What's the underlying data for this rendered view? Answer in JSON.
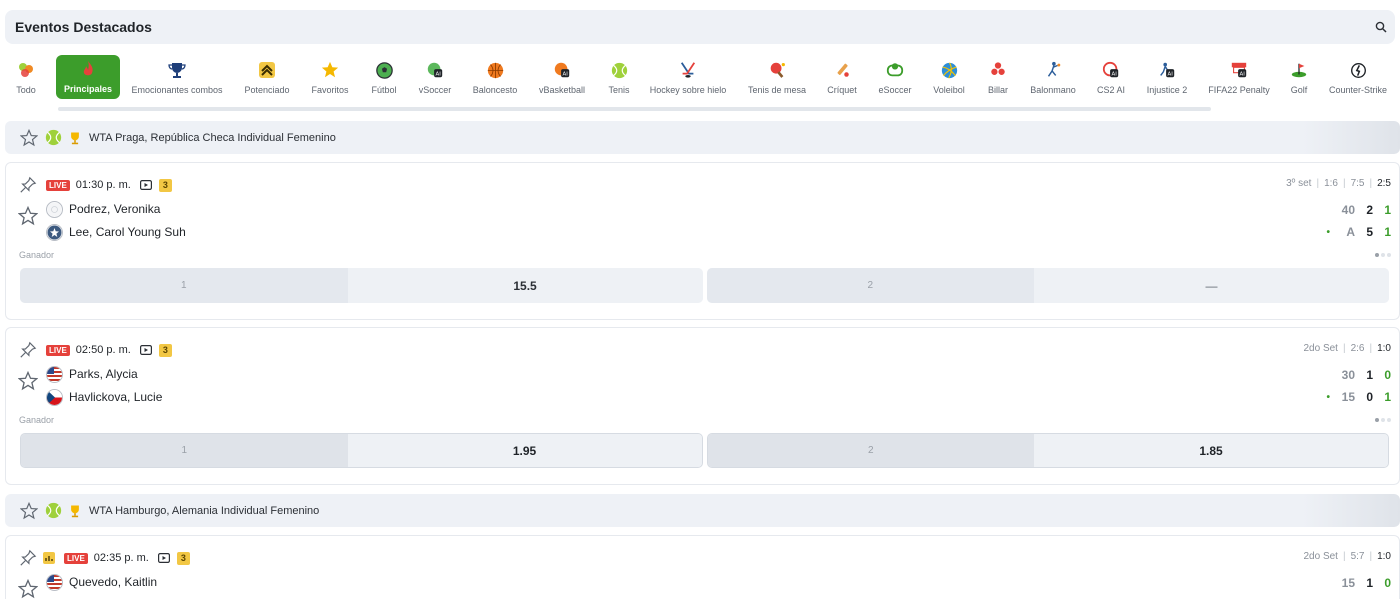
{
  "header": {
    "title": "Eventos Destacados"
  },
  "sports": [
    {
      "label": "Todo",
      "icon": "all-sports-icon"
    },
    {
      "label": "Principales",
      "icon": "flame-icon",
      "active": true
    },
    {
      "label": "Emocionantes combos",
      "icon": "trophy-icon"
    },
    {
      "label": "Potenciado",
      "icon": "boost-icon"
    },
    {
      "label": "Favoritos",
      "icon": "star-icon"
    },
    {
      "label": "Fútbol",
      "icon": "soccer-ball-icon"
    },
    {
      "label": "vSoccer",
      "icon": "vsoccer-icon"
    },
    {
      "label": "Baloncesto",
      "icon": "basketball-icon"
    },
    {
      "label": "vBasketball",
      "icon": "vbasketball-icon"
    },
    {
      "label": "Tenis",
      "icon": "tennis-ball-icon"
    },
    {
      "label": "Hockey sobre hielo",
      "icon": "hockey-icon"
    },
    {
      "label": "Tenis de mesa",
      "icon": "table-tennis-icon"
    },
    {
      "label": "Críquet",
      "icon": "cricket-icon"
    },
    {
      "label": "eSoccer",
      "icon": "esoccer-icon"
    },
    {
      "label": "Voleibol",
      "icon": "volleyball-icon"
    },
    {
      "label": "Billar",
      "icon": "billiards-icon"
    },
    {
      "label": "Balonmano",
      "icon": "handball-icon"
    },
    {
      "label": "CS2 AI",
      "icon": "cs2-icon"
    },
    {
      "label": "Injustice 2",
      "icon": "injustice-icon"
    },
    {
      "label": "FIFA22 Penalty",
      "icon": "fifa-penalty-icon"
    },
    {
      "label": "Golf",
      "icon": "golf-icon"
    },
    {
      "label": "Counter-Strike",
      "icon": "counter-strike-icon"
    }
  ],
  "leagues": [
    {
      "name": "WTA Praga, República Checa Individual Femenino"
    },
    {
      "name": "WTA Hamburgo, Alemania Individual Femenino"
    }
  ],
  "events": [
    {
      "live": "LIVE",
      "time": "01:30 p. m.",
      "count": "3",
      "set_label": "3º set",
      "set_scores": [
        "1:6",
        "7:5"
      ],
      "current": "2:5",
      "players": [
        {
          "name": "Podrez, Veronika",
          "points": "40",
          "games": "2",
          "sets": "1",
          "serve": ""
        },
        {
          "name": "Lee, Carol Young Suh",
          "points": "A",
          "games": "5",
          "sets": "1",
          "serve": "•"
        }
      ],
      "market": "Ganador",
      "odds": [
        {
          "sel": "1",
          "val": "15.5"
        },
        {
          "sel": "2",
          "val": "—"
        }
      ]
    },
    {
      "live": "LIVE",
      "time": "02:50 p. m.",
      "count": "3",
      "set_label": "2do Set",
      "set_scores": [
        "2:6"
      ],
      "current": "1:0",
      "players": [
        {
          "name": "Parks, Alycia",
          "points": "30",
          "games": "1",
          "sets": "0",
          "serve": ""
        },
        {
          "name": "Havlickova, Lucie",
          "points": "15",
          "games": "0",
          "sets": "1",
          "serve": "•"
        }
      ],
      "market": "Ganador",
      "odds": [
        {
          "sel": "1",
          "val": "1.95"
        },
        {
          "sel": "2",
          "val": "1.85"
        }
      ]
    },
    {
      "live": "LIVE",
      "time": "02:35 p. m.",
      "count": "3",
      "set_label": "2do Set",
      "set_scores": [
        "5:7"
      ],
      "current": "1:0",
      "players": [
        {
          "name": "Quevedo, Kaitlin",
          "points": "15",
          "games": "1",
          "sets": "0",
          "serve": ""
        }
      ]
    }
  ],
  "colors": {
    "accent": "#3c9d2b",
    "live": "#e5413b",
    "badge": "#f2c744"
  }
}
